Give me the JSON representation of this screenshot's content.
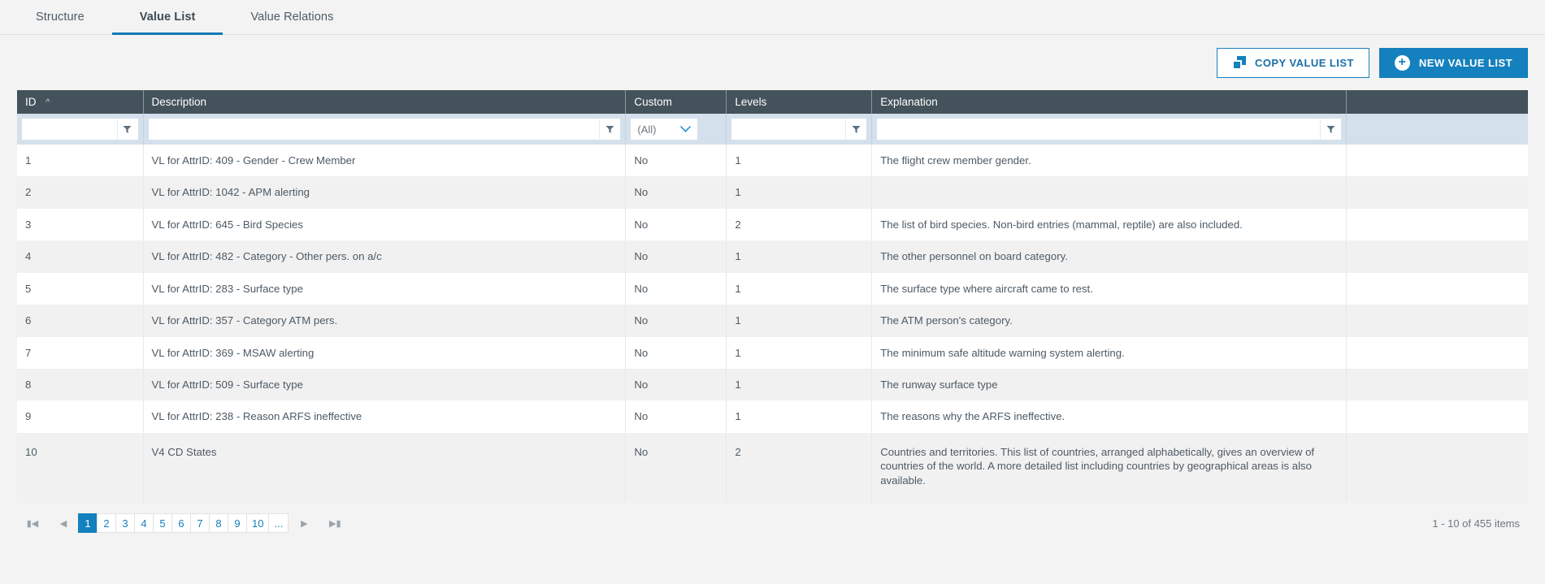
{
  "tabs": [
    {
      "label": "Structure",
      "active": false
    },
    {
      "label": "Value List",
      "active": true
    },
    {
      "label": "Value Relations",
      "active": false
    }
  ],
  "toolbar": {
    "copy_label": "COPY VALUE LIST",
    "new_label": "NEW VALUE LIST",
    "copy_icon": "copy-icon",
    "new_icon": "plus-circle-icon",
    "accent_color": "#1480bd"
  },
  "grid": {
    "columns": [
      {
        "key": "id",
        "label": "ID",
        "sort": "asc"
      },
      {
        "key": "description",
        "label": "Description",
        "sort": ""
      },
      {
        "key": "custom",
        "label": "Custom",
        "sort": ""
      },
      {
        "key": "levels",
        "label": "Levels",
        "sort": ""
      },
      {
        "key": "explanation",
        "label": "Explanation",
        "sort": ""
      },
      {
        "key": "spacer",
        "label": "",
        "sort": ""
      }
    ],
    "filters": {
      "id": {
        "value": "",
        "placeholder": "",
        "icon": "filter-funnel-icon"
      },
      "description": {
        "value": "",
        "placeholder": "",
        "icon": "filter-funnel-icon"
      },
      "custom": {
        "value": "(All)",
        "icon": "chevron-down-icon"
      },
      "levels": {
        "value": "",
        "placeholder": "",
        "icon": "filter-funnel-icon"
      },
      "explanation": {
        "value": "",
        "placeholder": "",
        "icon": "filter-funnel-icon"
      }
    },
    "rows": [
      {
        "id": "1",
        "description": "VL for AttrID: 409 - Gender - Crew Member",
        "custom": "No",
        "levels": "1",
        "explanation": "The flight crew member gender."
      },
      {
        "id": "2",
        "description": "VL for AttrID: 1042 - APM alerting",
        "custom": "No",
        "levels": "1",
        "explanation": ""
      },
      {
        "id": "3",
        "description": "VL for AttrID: 645 - Bird Species",
        "custom": "No",
        "levels": "2",
        "explanation": "The list of bird species. Non-bird entries (mammal, reptile) are also included."
      },
      {
        "id": "4",
        "description": "VL for AttrID: 482 - Category - Other pers. on a/c",
        "custom": "No",
        "levels": "1",
        "explanation": "The other personnel on board category."
      },
      {
        "id": "5",
        "description": "VL for AttrID: 283 - Surface type",
        "custom": "No",
        "levels": "1",
        "explanation": "The surface type where aircraft came to rest."
      },
      {
        "id": "6",
        "description": "VL for AttrID: 357 - Category ATM pers.",
        "custom": "No",
        "levels": "1",
        "explanation": "The ATM person's category."
      },
      {
        "id": "7",
        "description": "VL for AttrID: 369 - MSAW alerting",
        "custom": "No",
        "levels": "1",
        "explanation": "The minimum safe altitude warning system alerting."
      },
      {
        "id": "8",
        "description": "VL for AttrID: 509 - Surface type",
        "custom": "No",
        "levels": "1",
        "explanation": "The runway surface type"
      },
      {
        "id": "9",
        "description": "VL for AttrID: 238 - Reason ARFS ineffective",
        "custom": "No",
        "levels": "1",
        "explanation": "The reasons why the ARFS ineffective."
      },
      {
        "id": "10",
        "description": "V4 CD States",
        "custom": "No",
        "levels": "2",
        "explanation": "Countries and territories. This list of countries, arranged alphabetically, gives an overview of countries of the world. A more detailed list including countries by geographical areas is also available."
      }
    ]
  },
  "pager": {
    "first_icon": "first-page-icon",
    "prev_icon": "previous-page-icon",
    "next_icon": "next-page-icon",
    "last_icon": "last-page-icon",
    "pages": [
      "1",
      "2",
      "3",
      "4",
      "5",
      "6",
      "7",
      "8",
      "9",
      "10",
      "..."
    ],
    "current": "1",
    "items_info": "1 - 10 of 455 items"
  }
}
